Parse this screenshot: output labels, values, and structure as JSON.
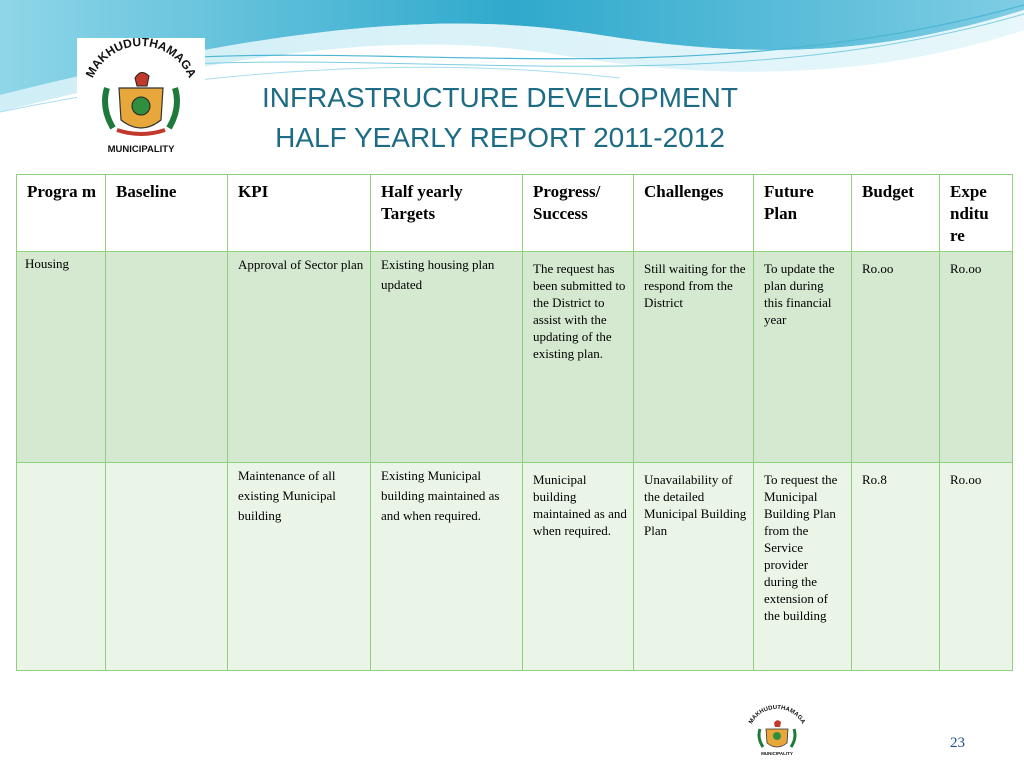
{
  "header": {
    "title_line1": "INFRASTRUCTURE DEVELOPMENT",
    "title_line2": "HALF YEARLY REPORT 2011-2012",
    "logo_text_arc": "MAKHUDUTHAMAGA",
    "logo_text_bottom": "MUNICIPALITY"
  },
  "table": {
    "headers": {
      "program": "Progra m",
      "baseline": "Baseline",
      "kpi": "KPI",
      "half_yearly_targets": "Half yearly Targets",
      "progress": "Progress/ Success",
      "challenges": "Challenges",
      "future_plan": "Future Plan",
      "budget": "Budget",
      "expenditure": "Expe nditu re"
    },
    "rows": [
      {
        "program": "Housing",
        "baseline": "",
        "kpi": "Approval of Sector plan",
        "target": "Existing housing plan updated",
        "progress": "The request has been submitted to the District to assist with the updating of the existing plan.",
        "challenges": "Still waiting for the respond from the District",
        "future_plan": "To update the plan during this financial year",
        "budget": "Ro.oo",
        "expenditure": "Ro.oo"
      },
      {
        "program": "",
        "baseline": "",
        "kpi": "Maintenance of all existing Municipal building",
        "target": "Existing Municipal building maintained as and when required.",
        "progress": "Municipal building maintained as and when required.",
        "challenges": "Unavailability of the detailed Municipal Building Plan",
        "future_plan": "To request the Municipal Building Plan from the Service provider during the extension of the building",
        "budget": "Ro.8",
        "expenditure": "Ro.oo"
      }
    ]
  },
  "footer": {
    "page_number": "23"
  },
  "colors": {
    "title": "#1d6b84",
    "border": "#8fd07f",
    "row1_bg": "#d4e9d0",
    "row2_bg": "#eaf5e7"
  }
}
